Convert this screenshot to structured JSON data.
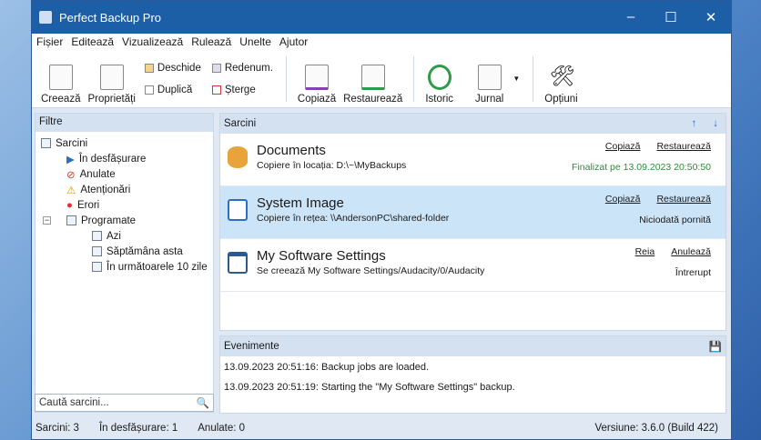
{
  "title": "Perfect Backup Pro",
  "menu": [
    "Fișier",
    "Editează",
    "Vizualizează",
    "Rulează",
    "Unelte",
    "Ajutor"
  ],
  "toolbar": {
    "create": "Creează",
    "props": "Proprietăți",
    "open": "Deschide",
    "duplicate": "Duplică",
    "rename": "Redenum.",
    "delete": "Șterge",
    "copy": "Copiază",
    "restore": "Restaurează",
    "history": "Istoric",
    "log": "Jurnal",
    "options": "Opțiuni"
  },
  "filters": {
    "header": "Filtre",
    "root": "Sarcini",
    "items": [
      "În desfășurare",
      "Anulate",
      "Atenționări",
      "Erori",
      "Programate"
    ],
    "sub": [
      "Azi",
      "Săptămâna asta",
      "În următoarele 10 zile"
    ]
  },
  "search": {
    "placeholder": "Caută sarcini..."
  },
  "tasks": {
    "header": "Sarcini",
    "rows": [
      {
        "name": "Documents",
        "desc": "Copiere în locația: D:\\~\\MyBackups",
        "a1": "Copiază",
        "a2": "Restaurează",
        "status": "Finalizat pe 13.09.2023 20:50:50"
      },
      {
        "name": "System Image",
        "desc": "Copiere în rețea: \\\\AndersonPC\\shared-folder",
        "a1": "Copiază",
        "a2": "Restaurează",
        "status": "Niciodată pornită"
      },
      {
        "name": "My Software Settings",
        "desc": "Se creează My Software Settings/Audacity/0/Audacity",
        "a1": "Reia",
        "a2": "Anulează",
        "status": "Întrerupt"
      }
    ]
  },
  "events": {
    "header": "Evenimente",
    "lines": [
      "13.09.2023 20:51:16: Backup jobs are loaded.",
      "13.09.2023 20:51:19: Starting the \"My Software Settings\" backup."
    ]
  },
  "status": {
    "tasks": "Sarcini: 3",
    "running": "În desfășurare: 1",
    "cancelled": "Anulate: 0",
    "version": "Versiune: 3.6.0 (Build 422)"
  },
  "colors": {
    "titlebar": "#1d5fa6",
    "success": "#2e8b3a",
    "selected": "#cce4f7"
  }
}
